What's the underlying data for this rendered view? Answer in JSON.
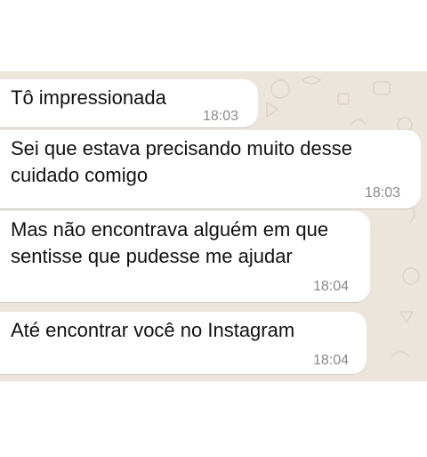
{
  "messages": [
    {
      "text": "Tô impressionada",
      "time": "18:03"
    },
    {
      "text": "Sei que estava precisando muito desse\ncuidado comigo",
      "time": "18:03"
    },
    {
      "text": "Mas não encontrava alguém em que\nsentisse que pudesse me ajudar",
      "time": "18:04"
    },
    {
      "text": "Até encontrar você no Instagram",
      "time": "18:04"
    }
  ],
  "colors": {
    "chat_background": "#ece5dc",
    "bubble": "#ffffff",
    "timestamp": "#8a8a8a"
  }
}
